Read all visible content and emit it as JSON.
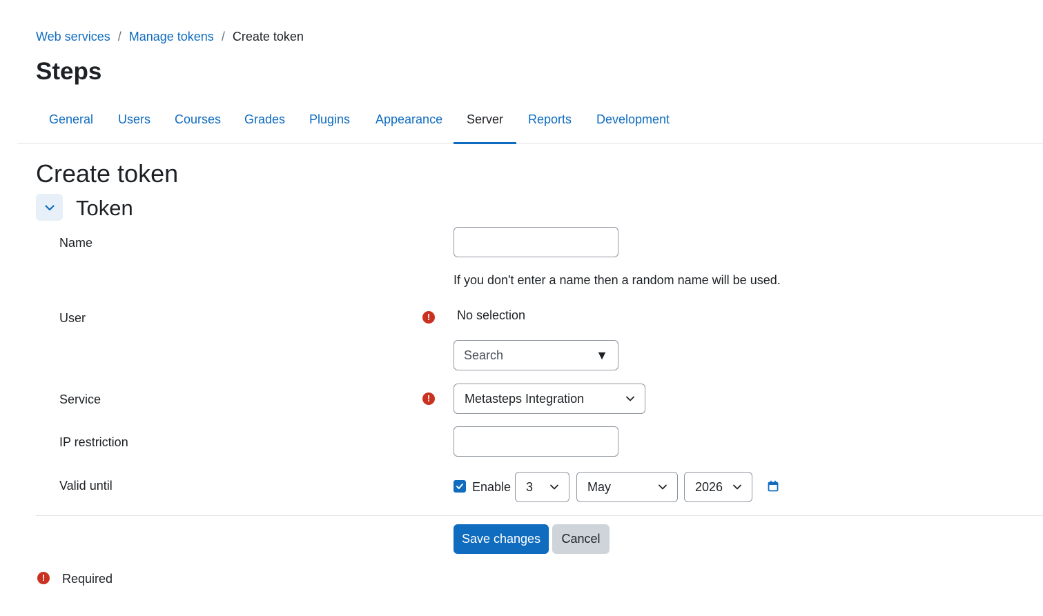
{
  "breadcrumb": {
    "items": [
      "Web services",
      "Manage tokens"
    ],
    "separator": "/",
    "current": "Create token"
  },
  "site_title": "Steps",
  "tabs": [
    {
      "label": "General",
      "active": false
    },
    {
      "label": "Users",
      "active": false
    },
    {
      "label": "Courses",
      "active": false
    },
    {
      "label": "Grades",
      "active": false
    },
    {
      "label": "Plugins",
      "active": false
    },
    {
      "label": "Appearance",
      "active": false
    },
    {
      "label": "Server",
      "active": true
    },
    {
      "label": "Reports",
      "active": false
    },
    {
      "label": "Development",
      "active": false
    }
  ],
  "page_heading": "Create token",
  "section": {
    "title": "Token",
    "expanded": true
  },
  "form": {
    "name": {
      "label": "Name",
      "value": "",
      "help": "If you don't enter a name then a random name will be used."
    },
    "user": {
      "label": "User",
      "required": true,
      "selection": "No selection",
      "search_placeholder": "Search",
      "dropdown_glyph": "▼"
    },
    "service": {
      "label": "Service",
      "required": true,
      "value": "Metasteps Integration"
    },
    "ip_restriction": {
      "label": "IP restriction",
      "value": ""
    },
    "valid_until": {
      "label": "Valid until",
      "enable_label": "Enable",
      "enabled": true,
      "day": "3",
      "month": "May",
      "year": "2026"
    }
  },
  "buttons": {
    "save": "Save changes",
    "cancel": "Cancel"
  },
  "required_note": {
    "icon_glyph": "!",
    "label": "Required"
  },
  "colors": {
    "link": "#0f6cbf",
    "primary": "#0f6cbf",
    "required": "#ca3120",
    "secondary_button": "#ced4da",
    "text": "#1d2125"
  },
  "icons": {
    "section_toggle": "chevron-down-icon",
    "required": "exclamation-circle-icon",
    "select_arrow": "chevron-down-icon",
    "calendar": "calendar-icon",
    "checkbox": "check-icon"
  }
}
